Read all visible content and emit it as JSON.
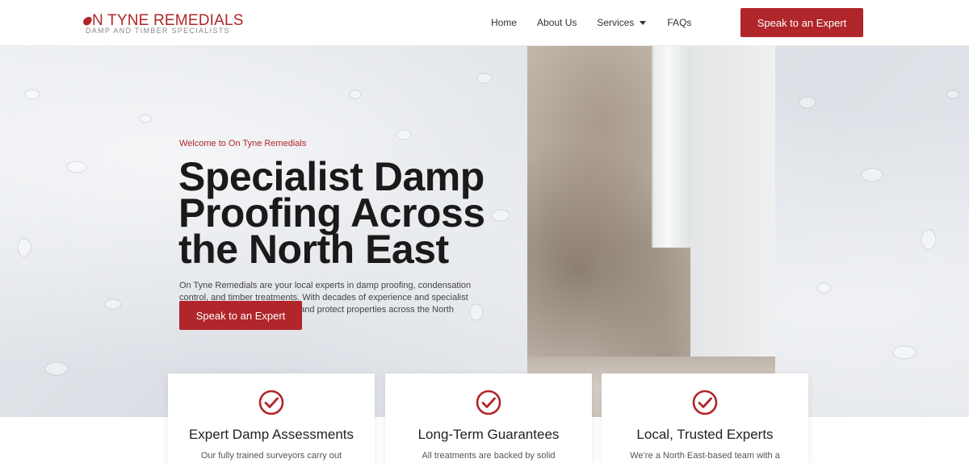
{
  "header": {
    "logo_main": "N TYNE REMEDIALS",
    "logo_sub": "DAMP AND TIMBER SPECIALISTS",
    "nav": {
      "home": "Home",
      "about": "About Us",
      "services": "Services",
      "faqs": "FAQs"
    },
    "cta_label": "Speak to an Expert"
  },
  "hero": {
    "eyebrow": "Welcome to On Tyne Remedials",
    "title_lines": [
      "Specialist Damp",
      "Proofing Across",
      "the North East"
    ],
    "body": "On Tyne Remedials are your local experts in damp proofing, condensation control, and timber treatments. With decades of experience and specialist knowledge, we restore homes and protect properties across the North East of England.",
    "cta_label": "Speak to an Expert"
  },
  "features": [
    {
      "title": "Expert Damp Assessments",
      "text": "Our fully trained surveyors carry out"
    },
    {
      "title": "Long-Term Guarantees",
      "text": "All treatments are backed by solid"
    },
    {
      "title": "Local, Trusted Experts",
      "text": "We’re a North East-based team with a"
    }
  ],
  "colors": {
    "accent": "#b0262a",
    "text_dark": "#1a1a1a"
  },
  "icons": {
    "feature_icon": "check-circle-icon",
    "services_caret": "caret-down-icon",
    "logo_mark": "drop-icon"
  }
}
